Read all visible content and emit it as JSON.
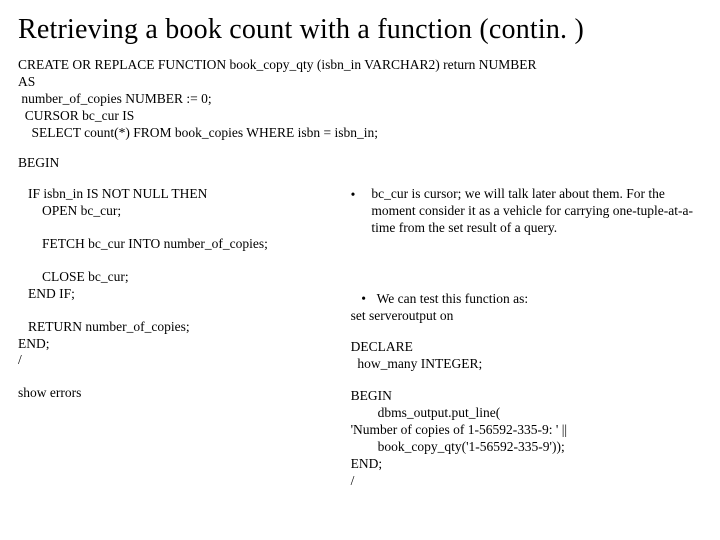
{
  "title": "Retrieving a book count with a function (contin. )",
  "code_top": {
    "l1": "CREATE OR REPLACE FUNCTION book_copy_qty (isbn_in VARCHAR2) return NUMBER",
    "l2": "AS",
    "l3": " number_of_copies NUMBER := 0;",
    "l4": "  CURSOR bc_cur IS",
    "l5": "    SELECT count(*) FROM book_copies WHERE isbn = isbn_in;"
  },
  "begin": "BEGIN",
  "left": {
    "block1": {
      "l1": "IF isbn_in IS NOT NULL THEN",
      "l2": "OPEN bc_cur;"
    },
    "block2": "FETCH bc_cur INTO number_of_copies;",
    "block3": {
      "l1": "CLOSE bc_cur;",
      "l2": "END IF;"
    },
    "block4": {
      "l1": "RETURN number_of_copies;",
      "l2": "END;",
      "l3": "/"
    },
    "block5": "show errors"
  },
  "right": {
    "bullet1": "bc_cur is cursor; we will talk later about them. For the moment consider it as a vehicle for carrying one-tuple-at-a-time from the set result of a query.",
    "bullet2_line": "We can test this function as:",
    "bullet2_extra": "set serveroutput on",
    "declare": {
      "l1": "DECLARE",
      "l2": "  how_many INTEGER;"
    },
    "begin_block": {
      "l1": "BEGIN",
      "l2": "        dbms_output.put_line(",
      "l3": "'Number of copies of 1-56592-335-9: ' ||",
      "l4": "        book_copy_qty('1-56592-335-9'));",
      "l5": "END;",
      "l6": "/"
    }
  },
  "bullet_symbol": "•"
}
